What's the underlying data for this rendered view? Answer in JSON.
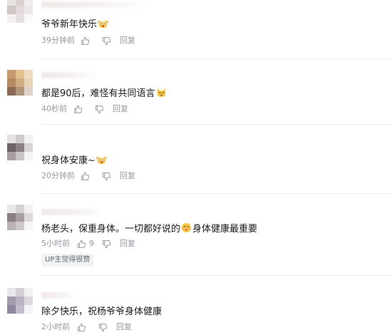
{
  "comments": [
    {
      "text": "爷爷新年快乐",
      "emoji": "surprised-cat-emoji",
      "time": "39分钟前",
      "like_count": "",
      "reply_label": "回复"
    },
    {
      "text": "都是90后，难怪有共同语言",
      "emoji": "cat-face-emoji",
      "time": "40秒前",
      "like_count": "",
      "reply_label": "回复"
    },
    {
      "text": "祝身体安康~",
      "emoji": "surprised-cat-emoji",
      "time": "20分钟前",
      "like_count": "",
      "reply_label": "回复"
    },
    {
      "text_before": "杨老头，保重身体。一切都好说的",
      "text_after": "身体健康最重要",
      "emoji": "kissing-face-emoji",
      "time": "5小时前",
      "like_count": "9",
      "reply_label": "回复",
      "tag": "UP主觉得很赞"
    },
    {
      "text": "除夕快乐，祝杨爷爷身体健康",
      "time": "2小时前",
      "like_count": "",
      "reply_label": "回复"
    }
  ],
  "icons": {
    "like": "thumbs-up-icon",
    "dislike": "thumbs-down-icon"
  },
  "colors": {
    "text": "#18191c",
    "meta": "#9499a0",
    "divider": "#e9ebee",
    "tag_bg": "#f1f2f3"
  }
}
